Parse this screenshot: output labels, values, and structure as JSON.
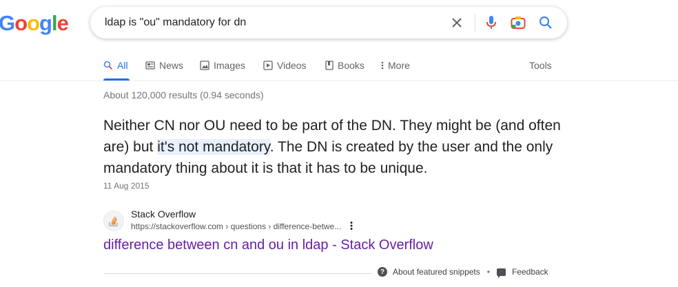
{
  "logo": {
    "letters": [
      "G",
      "o",
      "o",
      "g",
      "l",
      "e"
    ],
    "colors": [
      "#4285f4",
      "#ea4335",
      "#fbbc05",
      "#4285f4",
      "#34a853",
      "#ea4335"
    ]
  },
  "search": {
    "query": "ldap is \"ou\" mandatory for dn"
  },
  "tabs": [
    {
      "label": "All",
      "icon": "search-icon"
    },
    {
      "label": "News",
      "icon": "news-icon"
    },
    {
      "label": "Images",
      "icon": "image-icon"
    },
    {
      "label": "Videos",
      "icon": "play-icon"
    },
    {
      "label": "Books",
      "icon": "book-icon"
    },
    {
      "label": "More",
      "icon": "more-vert-icon"
    }
  ],
  "tools_label": "Tools",
  "stats": "About 120,000 results (0.94 seconds)",
  "snippet": {
    "before": "Neither CN nor OU need to be part of the DN. They might be (and often are) but ",
    "highlight": "it's not mandatory",
    "after": ". The DN is created by the user and the only mandatory thing about it is that it has to be unique.",
    "date": "11 Aug 2015"
  },
  "source": {
    "site_name": "Stack Overflow",
    "url": "https://stackoverflow.com › questions › difference-betwe...",
    "title": "difference between cn and ou in ldap - Stack Overflow"
  },
  "footer": {
    "about": "About featured snippets",
    "separator": "•",
    "feedback": "Feedback"
  },
  "colors": {
    "accent": "#1a73e8",
    "visited_link": "#681da8",
    "highlight": "#e8f0fe"
  }
}
